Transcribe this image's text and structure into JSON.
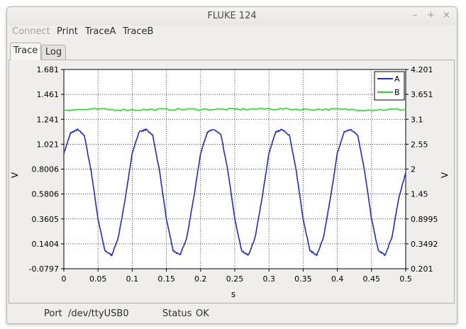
{
  "window": {
    "title": "FLUKE 124",
    "controls": [
      "–",
      "+",
      "×"
    ]
  },
  "menu": {
    "connect": "Connect",
    "print": "Print",
    "tracea": "TraceA",
    "traceb": "TraceB"
  },
  "tabs": {
    "trace": "Trace",
    "log": "Log",
    "active": "Trace"
  },
  "status": {
    "port_label": "Port",
    "port_value": "/dev/ttyUSB0",
    "status_label": "Status",
    "status_value": "OK"
  },
  "chart_data": {
    "type": "line",
    "xlabel": "s",
    "ylabel": "V",
    "ylabel_right": "V",
    "xlim": [
      0,
      0.5
    ],
    "ylim_left": [
      -0.0797,
      1.681
    ],
    "ylim_right": [
      0.201,
      4.201
    ],
    "x_ticks": [
      "0",
      "0.05",
      "0.1",
      "0.15",
      "0.2",
      "0.25",
      "0.3",
      "0.35",
      "0.4",
      "0.45",
      "0.5"
    ],
    "y_ticks_left": [
      "1.681",
      "1.461",
      "1.241",
      "1.021",
      "0.8006",
      "0.5806",
      "0.3605",
      "0.1404",
      "-0.0797"
    ],
    "y_ticks_right": [
      "4.201",
      "3.651",
      "3.1",
      "2.55",
      "2",
      "1.45",
      "0.8995",
      "0.3492",
      "0.201"
    ],
    "grid": true,
    "legend_position": "top-right",
    "series": [
      {
        "name": "A",
        "color": "#1c2ad8",
        "axis": "left",
        "shape": "clipped sine",
        "x": [
          0,
          0.01,
          0.02,
          0.03,
          0.04,
          0.05,
          0.06,
          0.07,
          0.08,
          0.09,
          0.1,
          0.11,
          0.12,
          0.13,
          0.14,
          0.15,
          0.16,
          0.17,
          0.18,
          0.19,
          0.2,
          0.21,
          0.22,
          0.23,
          0.24,
          0.25,
          0.26,
          0.27,
          0.28,
          0.29,
          0.3,
          0.31,
          0.32,
          0.33,
          0.34,
          0.35,
          0.36,
          0.37,
          0.38,
          0.39,
          0.4,
          0.41,
          0.42,
          0.43,
          0.44,
          0.45,
          0.46,
          0.47,
          0.48,
          0.49,
          0.5
        ],
        "y": [
          0.94,
          1.12,
          1.15,
          1.1,
          0.78,
          0.36,
          0.08,
          0.04,
          0.2,
          0.55,
          0.94,
          1.13,
          1.15,
          1.1,
          0.78,
          0.36,
          0.08,
          0.04,
          0.2,
          0.55,
          0.94,
          1.13,
          1.15,
          1.1,
          0.78,
          0.36,
          0.08,
          0.04,
          0.2,
          0.55,
          0.94,
          1.13,
          1.15,
          1.1,
          0.78,
          0.36,
          0.08,
          0.04,
          0.2,
          0.55,
          0.94,
          1.13,
          1.15,
          1.1,
          0.78,
          0.36,
          0.08,
          0.04,
          0.2,
          0.55,
          0.77
        ]
      },
      {
        "name": "B",
        "color": "#1ee21e",
        "axis": "right",
        "shape": "flat noisy",
        "x": [
          0,
          0.05,
          0.1,
          0.15,
          0.2,
          0.25,
          0.3,
          0.35,
          0.4,
          0.45,
          0.5
        ],
        "y": [
          3.39,
          3.4,
          3.39,
          3.4,
          3.4,
          3.4,
          3.41,
          3.4,
          3.4,
          3.39,
          3.4
        ]
      }
    ]
  }
}
